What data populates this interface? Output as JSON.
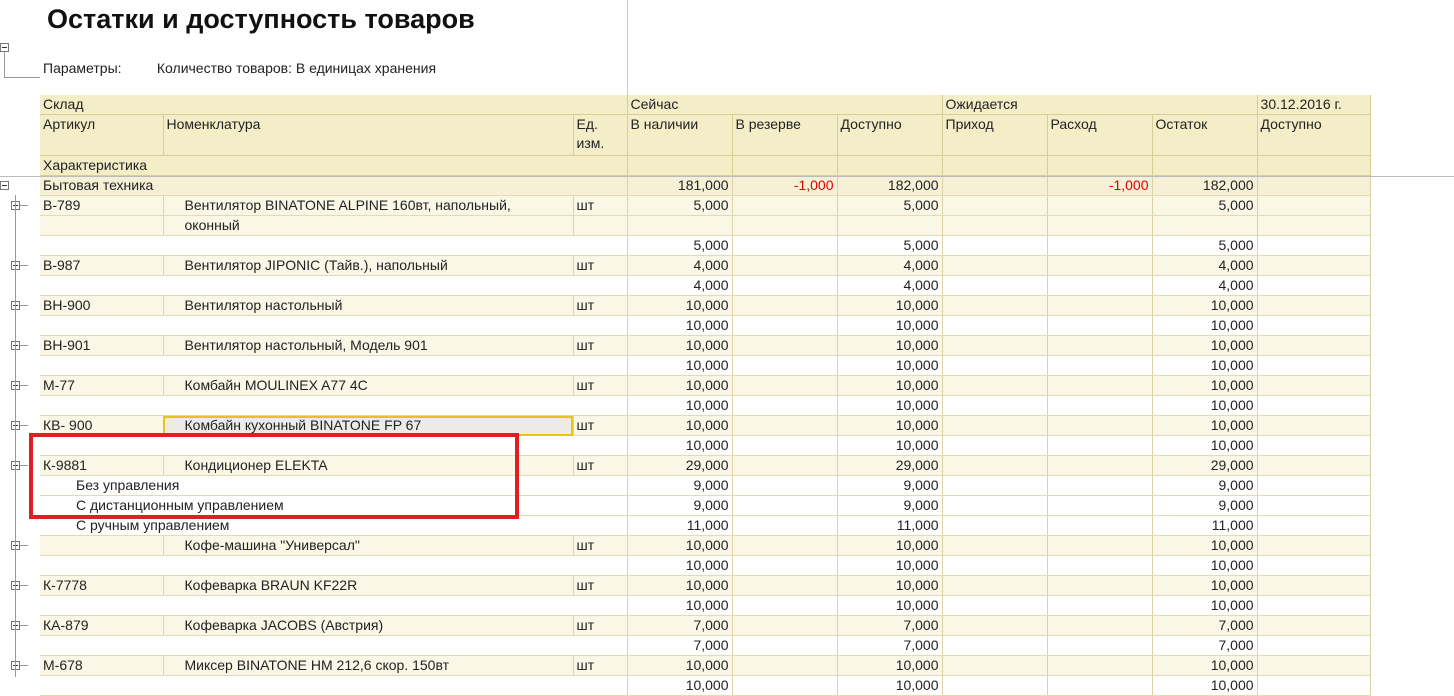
{
  "title": "Остатки и доступность товаров",
  "params": {
    "label": "Параметры:",
    "value": "Количество товаров: В единицах хранения"
  },
  "header": {
    "row1": {
      "warehouse": "Склад",
      "now": "Сейчас",
      "expected": "Ожидается",
      "date": "30.12.2016 г."
    },
    "row2": {
      "article": "Артикул",
      "nomenclature": "Номенклатура",
      "unit": "Ед. изм.",
      "in_stock": "В наличии",
      "reserve": "В резерве",
      "available": "Доступно",
      "income": "Приход",
      "expense": "Расход",
      "balance": "Остаток",
      "available2": "Доступно"
    },
    "row3": {
      "characteristic": "Характеристика"
    }
  },
  "group": {
    "name": "Бытовая техника",
    "in_stock": "181,000",
    "reserve": "-1,000",
    "available": "182,000",
    "expense": "-1,000",
    "balance": "182,000"
  },
  "rows": [
    {
      "type": "item",
      "art": "В-789",
      "name": "Вентилятор BINATONE ALPINE 160вт, напольный,",
      "unit": "шт",
      "s": "5,000",
      "a": "5,000",
      "b": "5,000"
    },
    {
      "type": "cont",
      "name": "оконный"
    },
    {
      "type": "sub",
      "s": "5,000",
      "a": "5,000",
      "b": "5,000"
    },
    {
      "type": "item",
      "art": "В-987",
      "name": "Вентилятор JIPONIC (Тайв.), напольный",
      "unit": "шт",
      "s": "4,000",
      "a": "4,000",
      "b": "4,000"
    },
    {
      "type": "sub",
      "s": "4,000",
      "a": "4,000",
      "b": "4,000"
    },
    {
      "type": "item",
      "art": "ВН-900",
      "name": "Вентилятор настольный",
      "unit": "шт",
      "s": "10,000",
      "a": "10,000",
      "b": "10,000"
    },
    {
      "type": "sub",
      "s": "10,000",
      "a": "10,000",
      "b": "10,000"
    },
    {
      "type": "item",
      "art": "ВН-901",
      "name": "Вентилятор настольный, Модель 901",
      "unit": "шт",
      "s": "10,000",
      "a": "10,000",
      "b": "10,000"
    },
    {
      "type": "sub",
      "s": "10,000",
      "a": "10,000",
      "b": "10,000"
    },
    {
      "type": "item",
      "art": "М-77",
      "name": "Комбайн MOULINEX  A77 4C",
      "unit": "шт",
      "s": "10,000",
      "a": "10,000",
      "b": "10,000"
    },
    {
      "type": "sub",
      "s": "10,000",
      "a": "10,000",
      "b": "10,000"
    },
    {
      "type": "item",
      "art": "КВ- 900",
      "name": "Комбайн кухонный BINATONE FP 67",
      "unit": "шт",
      "s": "10,000",
      "a": "10,000",
      "b": "10,000",
      "selected": true
    },
    {
      "type": "sub",
      "s": "10,000",
      "a": "10,000",
      "b": "10,000"
    },
    {
      "type": "item",
      "art": "К-9881",
      "name": "Кондиционер ELEKTA",
      "unit": "шт",
      "s": "29,000",
      "a": "29,000",
      "b": "29,000"
    },
    {
      "type": "char",
      "char": "Без управления",
      "s": "9,000",
      "a": "9,000",
      "b": "9,000"
    },
    {
      "type": "char",
      "char": "С дистанционным управлением",
      "s": "9,000",
      "a": "9,000",
      "b": "9,000"
    },
    {
      "type": "char",
      "char": "С ручным управлением",
      "s": "11,000",
      "a": "11,000",
      "b": "11,000"
    },
    {
      "type": "item",
      "art": "",
      "name": "Кофе-машина \"Универсал\"",
      "unit": "шт",
      "s": "10,000",
      "a": "10,000",
      "b": "10,000"
    },
    {
      "type": "sub",
      "s": "10,000",
      "a": "10,000",
      "b": "10,000"
    },
    {
      "type": "item",
      "art": "К-7778",
      "name": "Кофеварка BRAUN KF22R",
      "unit": "шт",
      "s": "10,000",
      "a": "10,000",
      "b": "10,000"
    },
    {
      "type": "sub",
      "s": "10,000",
      "a": "10,000",
      "b": "10,000"
    },
    {
      "type": "item",
      "art": "КА-879",
      "name": "Кофеварка JACOBS (Австрия)",
      "unit": "шт",
      "s": "7,000",
      "a": "7,000",
      "b": "7,000"
    },
    {
      "type": "sub",
      "s": "7,000",
      "a": "7,000",
      "b": "7,000"
    },
    {
      "type": "item",
      "art": "М-678",
      "name": "Миксер BINATONE HM 212,6 скор. 150вт",
      "unit": "шт",
      "s": "10,000",
      "a": "10,000",
      "b": "10,000"
    },
    {
      "type": "sub",
      "s": "10,000",
      "a": "10,000",
      "b": "10,000"
    }
  ]
}
